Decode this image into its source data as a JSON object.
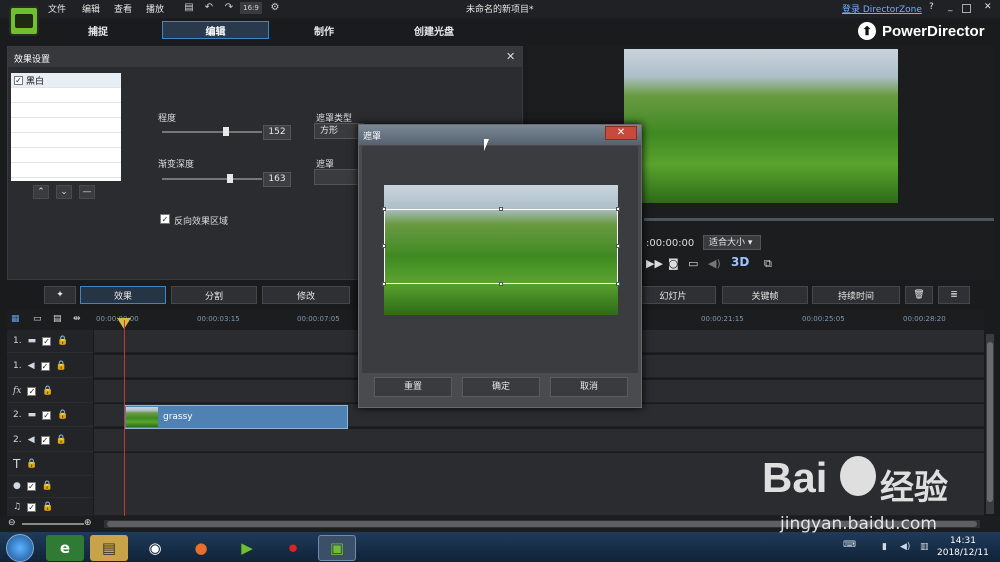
{
  "menubar": {
    "items": [
      "文件",
      "编辑",
      "查看",
      "播放"
    ],
    "title": "未命名的新项目*",
    "login_link": "登录 DirectorZone",
    "help": "?",
    "aspect_label": "16:9"
  },
  "tabs": [
    {
      "label": "捕捉"
    },
    {
      "label": "编辑"
    },
    {
      "label": "制作"
    },
    {
      "label": "创建光盘"
    }
  ],
  "brand": "PowerDirector",
  "effect_panel": {
    "title": "效果设置",
    "list_items": [
      {
        "label": "黑白",
        "checked": true
      }
    ],
    "degree_label": "程度",
    "degree_value": "152",
    "degree_level": 0.64,
    "feather_label": "渐变深度",
    "feather_value": "163",
    "feather_level": 0.68,
    "mask_type_label": "遮罩类型",
    "mask_type_value": "方形",
    "mask_label": "遮罩",
    "invert_label": "反向效果区域",
    "invert_checked": true
  },
  "preview": {
    "timecode": ":00:00:00",
    "fit_label": "适合大小"
  },
  "toolbar": {
    "effect": "效果",
    "split": "分割",
    "modify": "修改",
    "slideshow": "幻灯片",
    "keyframe": "关键帧",
    "duration": "持续时间"
  },
  "timeline": {
    "ticks": [
      "00:00:00:00",
      "00:00:03:15",
      "00:00:07:05",
      "00:00:21:15",
      "00:00:25:05",
      "00:00:28:20"
    ],
    "tracks": [
      "1.",
      "1.",
      "fx",
      "2.",
      "2.",
      "T",
      "mic",
      "music"
    ],
    "clip_label": "grassy"
  },
  "dialog": {
    "title": "遮罩",
    "reset": "重置",
    "ok": "确定",
    "cancel": "取消"
  },
  "taskbar": {
    "time": "14:31",
    "date": "2018/12/11"
  },
  "watermark": {
    "brand": "Bai",
    "brand2": "经验",
    "url": "jingyan.baidu.com"
  }
}
